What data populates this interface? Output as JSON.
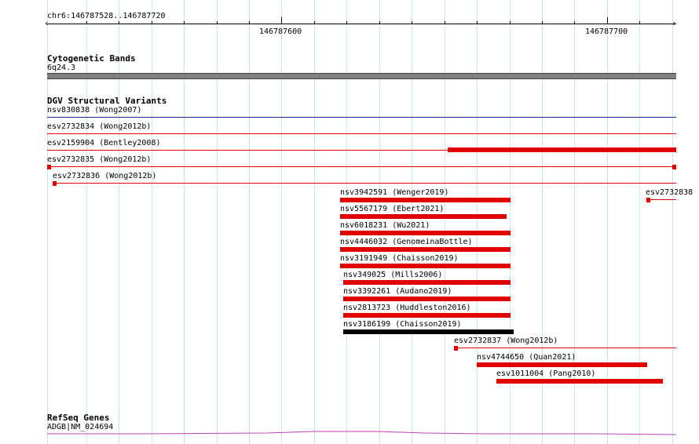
{
  "ruler": {
    "location": "chr6:146787528..146787720",
    "major_ticks": [
      "146787600",
      "146787700"
    ]
  },
  "cytoband": {
    "title": "Cytogenetic Bands",
    "label": "6q24.3"
  },
  "dgv": {
    "title": "DGV Structural Variants",
    "features": [
      {
        "label": "nsv830838 (Wong2007)",
        "color": "#1b2b8c"
      },
      {
        "label": "esv2732834 (Wong2012b)",
        "color": "#e00000"
      },
      {
        "label": "esv2159904 (Bentley2008)",
        "color": "#e00000"
      },
      {
        "label": "esv2732835 (Wong2012b)",
        "color": "#e00000"
      },
      {
        "label": "esv2732836 (Wong2012b)",
        "color": "#e00000"
      },
      {
        "label": "esv2732838",
        "color": "#e00000"
      },
      {
        "label": "nsv3942591 (Wenger2019)",
        "color": "#e00000"
      },
      {
        "label": "nsv5567179 (Ebert2021)",
        "color": "#e00000"
      },
      {
        "label": "nsv6018231 (Wu2021)",
        "color": "#e00000"
      },
      {
        "label": "nsv4446032 (GenomeinaBottle)",
        "color": "#e00000"
      },
      {
        "label": "nsv3191949 (Chaisson2019)",
        "color": "#e00000"
      },
      {
        "label": "nsv349025 (Mills2006)",
        "color": "#e00000"
      },
      {
        "label": "nsv3392261 (Audano2019)",
        "color": "#e00000"
      },
      {
        "label": "nsv2813723 (Huddleston2016)",
        "color": "#e00000"
      },
      {
        "label": "nsv3186199 (Chaisson2019)",
        "color": "#000000"
      },
      {
        "label": "esv2732837 (Wong2012b)",
        "color": "#e00000"
      },
      {
        "label": "nsv4744650 (Quan2021)",
        "color": "#e00000"
      },
      {
        "label": "esv1011004 (Pang2010)",
        "color": "#e00000"
      }
    ]
  },
  "refseq": {
    "title": "RefSeq Genes",
    "gene_label": "ADGB|NM_024694",
    "color": "#c040c0"
  }
}
